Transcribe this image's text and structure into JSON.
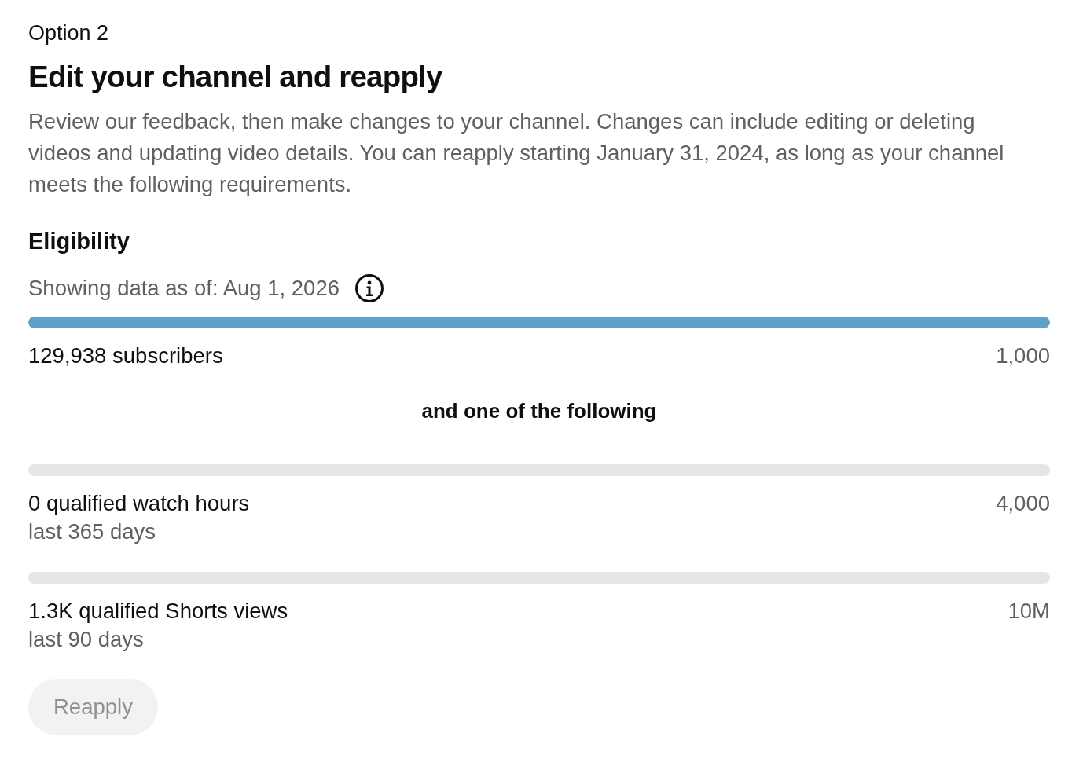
{
  "option_label": "Option 2",
  "title": "Edit your channel and reapply",
  "description": "Review our feedback, then make changes to your channel. Changes can include editing or deleting videos and updating video details. You can reapply starting January 31, 2024, as long as your channel meets the following requirements.",
  "eligibility": {
    "heading": "Eligibility",
    "data_as_of": "Showing data as of: Aug 1, 2026",
    "requirements": [
      {
        "label": "129,938 subscribers",
        "target": "1,000",
        "level": 1
      }
    ],
    "separator": "and one of the following",
    "alternatives": [
      {
        "label": "0 qualified watch hours",
        "period": "last 365 days",
        "target": "4,000",
        "level": 0
      },
      {
        "label": "1.3K qualified Shorts views",
        "period": "last 90 days",
        "target": "10M",
        "level": 0
      }
    ]
  },
  "reapply_button": {
    "label": "Reapply",
    "disabled": true
  }
}
